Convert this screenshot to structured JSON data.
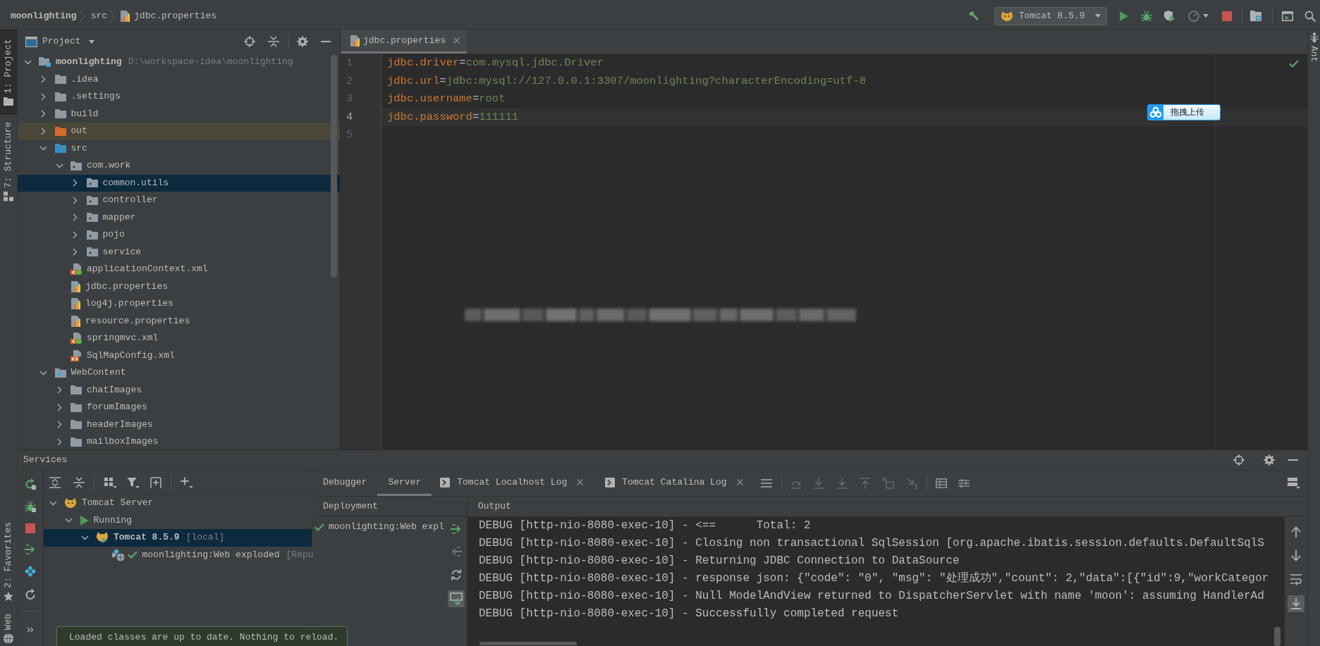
{
  "breadcrumbs": [
    {
      "label": "moonlighting",
      "kind": "module"
    },
    {
      "label": "src",
      "kind": "folder"
    },
    {
      "label": "jdbc.properties",
      "kind": "properties"
    }
  ],
  "run_configuration": {
    "label": "Tomcat 8.5.9"
  },
  "left_tool_windows": [
    {
      "label": "1: Project",
      "kind": "project",
      "selected": true
    },
    {
      "label": "7: Structure",
      "kind": "structure",
      "selected": false
    }
  ],
  "left_bottom_tool_windows": [
    {
      "label": "2: Favorites",
      "kind": "favorites",
      "selected": false
    },
    {
      "label": "Web",
      "kind": "web",
      "selected": false
    }
  ],
  "right_tool_windows": [
    {
      "label": "Ant",
      "kind": "ant",
      "selected": false
    }
  ],
  "project_panel": {
    "title": "Project",
    "tree": [
      {
        "label": "moonlighting",
        "path": "D:\\workspace-idea\\moonlighting",
        "kind": "module",
        "expanded": true,
        "selected": false,
        "children": [
          {
            "label": ".idea",
            "kind": "folder",
            "expanded": false,
            "selected": false
          },
          {
            "label": ".settings",
            "kind": "folder",
            "expanded": false,
            "selected": false
          },
          {
            "label": "build",
            "kind": "folder",
            "expanded": false,
            "selected": false
          },
          {
            "label": "out",
            "kind": "excluded-folder",
            "expanded": false,
            "selected": false
          },
          {
            "label": "src",
            "kind": "source-folder",
            "expanded": true,
            "selected": false,
            "children": [
              {
                "label": "com.work",
                "kind": "package",
                "expanded": true,
                "selected": false,
                "children": [
                  {
                    "label": "common.utils",
                    "kind": "package",
                    "expanded": false,
                    "selected": true
                  },
                  {
                    "label": "controller",
                    "kind": "package",
                    "expanded": false,
                    "selected": false
                  },
                  {
                    "label": "mapper",
                    "kind": "package",
                    "expanded": false,
                    "selected": false
                  },
                  {
                    "label": "pojo",
                    "kind": "package",
                    "expanded": false,
                    "selected": false
                  },
                  {
                    "label": "service",
                    "kind": "package",
                    "expanded": false,
                    "selected": false
                  }
                ]
              },
              {
                "label": "applicationContext.xml",
                "kind": "spring-xml",
                "selected": false
              },
              {
                "label": "jdbc.properties",
                "kind": "properties",
                "selected": false
              },
              {
                "label": "log4j.properties",
                "kind": "properties",
                "selected": false
              },
              {
                "label": "resource.properties",
                "kind": "properties",
                "selected": false
              },
              {
                "label": "springmvc.xml",
                "kind": "spring-xml",
                "selected": false
              },
              {
                "label": "SqlMapConfig.xml",
                "kind": "xml",
                "selected": false
              }
            ]
          },
          {
            "label": "WebContent",
            "kind": "web-folder",
            "expanded": true,
            "selected": false,
            "children": [
              {
                "label": "chatImages",
                "kind": "folder",
                "expanded": false,
                "selected": false
              },
              {
                "label": "forumImages",
                "kind": "folder",
                "expanded": false,
                "selected": false
              },
              {
                "label": "headerImages",
                "kind": "folder",
                "expanded": false,
                "selected": false
              },
              {
                "label": "mailboxImages",
                "kind": "folder",
                "expanded": false,
                "selected": false
              }
            ]
          }
        ]
      }
    ]
  },
  "editor": {
    "tabs": [
      {
        "label": "jdbc.properties",
        "kind": "properties",
        "selected": true
      }
    ],
    "lines": [
      {
        "number": "1",
        "key": "jdbc.driver",
        "separator": "=",
        "value": "com.mysql.jdbc.Driver",
        "current": false
      },
      {
        "number": "2",
        "key": "jdbc.url",
        "separator": "=",
        "value": "jdbc:mysql://127.0.0.1:3307/moonlighting?characterEncoding=utf-8",
        "current": false
      },
      {
        "number": "3",
        "key": "jdbc.username",
        "separator": "=",
        "value": "root",
        "current": false
      },
      {
        "number": "4",
        "key": "jdbc.password",
        "separator": "=",
        "value": "111111",
        "current": true
      },
      {
        "number": "5",
        "current": false
      }
    ]
  },
  "upload_widget": {
    "label": "拖拽上传"
  },
  "services": {
    "title": "Services",
    "tree": [
      {
        "label": "Tomcat Server",
        "kind": "server-group",
        "expanded": true,
        "selected": false,
        "children": [
          {
            "label": "Running",
            "kind": "status-running",
            "expanded": true,
            "selected": false,
            "children": [
              {
                "label": "Tomcat 8.5.9",
                "suffix": "[local]",
                "kind": "server",
                "expanded": true,
                "selected": true,
                "children": [
                  {
                    "label": "moonlighting:Web exploded",
                    "suffix": "[Repu",
                    "kind": "artifact",
                    "deployed": true,
                    "selected": false
                  }
                ]
              }
            ]
          }
        ]
      }
    ],
    "tabs": [
      {
        "label": "Debugger",
        "kind": "plain",
        "selected": false
      },
      {
        "label": "Server",
        "kind": "plain",
        "selected": true
      },
      {
        "label": "Tomcat Localhost Log",
        "kind": "log",
        "selected": false
      },
      {
        "label": "Tomcat Catalina Log",
        "kind": "log",
        "selected": false
      }
    ],
    "deployment": {
      "title": "Deployment",
      "items": [
        {
          "label": "moonlighting:Web expl",
          "deployed": true
        }
      ]
    },
    "output": {
      "title": "Output",
      "lines": [
        "DEBUG [http-nio-8080-exec-10] - <==      Total: 2",
        "DEBUG [http-nio-8080-exec-10] - Closing non transactional SqlSession [org.apache.ibatis.session.defaults.DefaultSqlS",
        "DEBUG [http-nio-8080-exec-10] - Returning JDBC Connection to DataSource",
        "DEBUG [http-nio-8080-exec-10] - response json: {\"code\": \"0\", \"msg\": \"处理成功\",\"count\": 2,\"data\":[{\"id\":9,\"workCategor",
        "DEBUG [http-nio-8080-exec-10] - Null ModelAndView returned to DispatcherServlet with name 'moon': assuming HandlerAd",
        "DEBUG [http-nio-8080-exec-10] - Successfully completed request"
      ]
    }
  },
  "notification": {
    "text": "Loaded classes are up to date. Nothing to reload."
  }
}
